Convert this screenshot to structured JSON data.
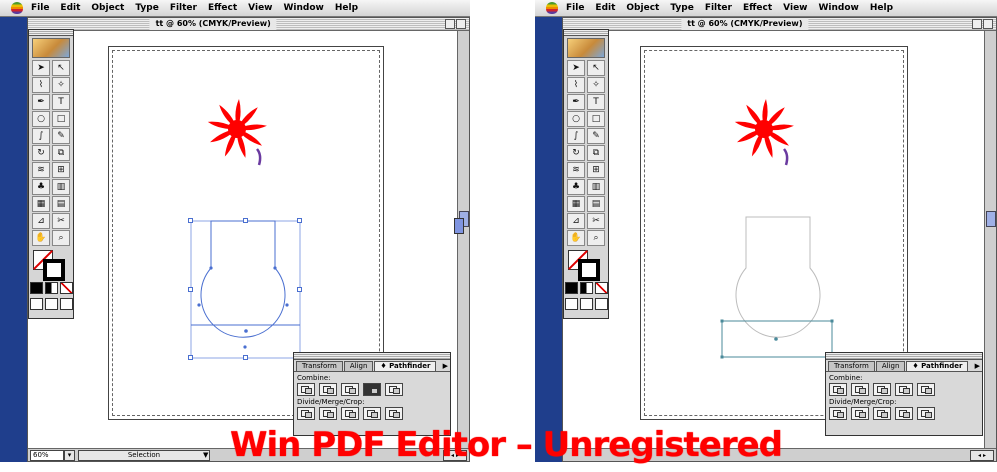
{
  "menubar": {
    "items": [
      "File",
      "Edit",
      "Object",
      "Type",
      "Filter",
      "Effect",
      "View",
      "Window",
      "Help"
    ]
  },
  "document": {
    "title": "tt @ 60% (CMYK/Preview)",
    "zoom": "60%",
    "status": "Selection"
  },
  "pathfinder": {
    "tabs": [
      "Transform",
      "Align",
      "♦ Pathfinder"
    ],
    "combine_label": "Combine:",
    "divide_label": "Divide/Merge/Crop:"
  },
  "tools": [
    "selection-tool",
    "direct-selection-tool",
    "lasso-tool",
    "magic-wand-tool",
    "pen-tool",
    "type-tool",
    "ellipse-tool",
    "rectangle-tool",
    "paintbrush-tool",
    "pencil-tool",
    "rotate-tool",
    "scale-tool",
    "warp-tool",
    "free-transform-tool",
    "symbol-tool",
    "graph-tool",
    "mesh-tool",
    "gradient-tool",
    "eyedropper-tool",
    "scissors-tool",
    "hand-tool",
    "zoom-tool"
  ],
  "artwork": {
    "star_color": "#ff0000",
    "stem_color": "#6a3aa0",
    "left_path_color": "#4a6fd0",
    "right_path_color": "#bcbcbc"
  },
  "watermark": "Win PDF Editor – Unregistered"
}
